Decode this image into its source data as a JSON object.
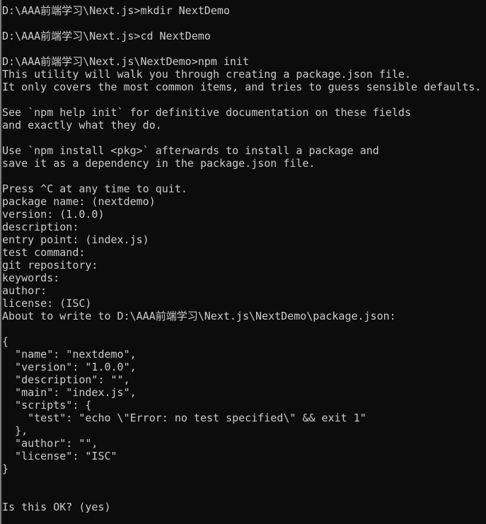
{
  "window": {
    "type": "windows-command-prompt",
    "background_color": "#0c0c0c",
    "foreground_color": "#cccccc",
    "border_color": "#8e8e8e"
  },
  "terminal": {
    "prompt_base": "D:\\AAA前端学习\\Next.js",
    "prompt_sub": "D:\\AAA前端学习\\Next.js\\NextDemo",
    "lines": [
      "D:\\AAA前端学习\\Next.js>mkdir NextDemo",
      "",
      "D:\\AAA前端学习\\Next.js>cd NextDemo",
      "",
      "D:\\AAA前端学习\\Next.js\\NextDemo>npm init",
      "This utility will walk you through creating a package.json file.",
      "It only covers the most common items, and tries to guess sensible defaults.",
      "",
      "See `npm help init` for definitive documentation on these fields",
      "and exactly what they do.",
      "",
      "Use `npm install <pkg>` afterwards to install a package and",
      "save it as a dependency in the package.json file.",
      "",
      "Press ^C at any time to quit.",
      "package name: (nextdemo)",
      "version: (1.0.0)",
      "description:",
      "entry point: (index.js)",
      "test command:",
      "git repository:",
      "keywords:",
      "author:",
      "license: (ISC)",
      "About to write to D:\\AAA前端学习\\Next.js\\NextDemo\\package.json:",
      "",
      "{",
      "  \"name\": \"nextdemo\",",
      "  \"version\": \"1.0.0\",",
      "  \"description\": \"\",",
      "  \"main\": \"index.js\",",
      "  \"scripts\": {",
      "    \"test\": \"echo \\\"Error: no test specified\\\" && exit 1\"",
      "  },",
      "  \"author\": \"\",",
      "  \"license\": \"ISC\"",
      "}",
      "",
      "",
      "Is this OK? (yes)"
    ],
    "commands": [
      "mkdir NextDemo",
      "cd NextDemo",
      "npm init"
    ],
    "npm_init_prompts": [
      {
        "label": "package name:",
        "default": "(nextdemo)"
      },
      {
        "label": "version:",
        "default": "(1.0.0)"
      },
      {
        "label": "description:",
        "default": ""
      },
      {
        "label": "entry point:",
        "default": "(index.js)"
      },
      {
        "label": "test command:",
        "default": ""
      },
      {
        "label": "git repository:",
        "default": ""
      },
      {
        "label": "keywords:",
        "default": ""
      },
      {
        "label": "author:",
        "default": ""
      },
      {
        "label": "license:",
        "default": "(ISC)"
      }
    ],
    "package_json": {
      "name": "nextdemo",
      "version": "1.0.0",
      "description": "",
      "main": "index.js",
      "scripts": {
        "test": "echo \\\"Error: no test specified\\\" && exit 1"
      },
      "author": "",
      "license": "ISC"
    },
    "final_prompt": "Is this OK? (yes)",
    "target_file": "D:\\AAA前端学习\\Next.js\\NextDemo\\package.json"
  }
}
